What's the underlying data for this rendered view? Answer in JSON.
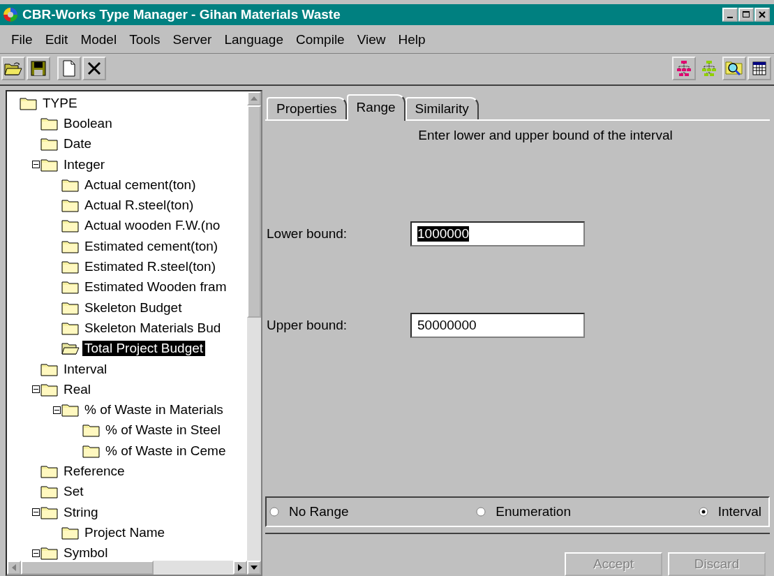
{
  "window": {
    "title": "CBR-Works Type Manager - Gihan Materials Waste"
  },
  "menu": [
    "File",
    "Edit",
    "Model",
    "Tools",
    "Server",
    "Language",
    "Compile",
    "View",
    "Help"
  ],
  "tree": [
    {
      "label": "TYPE",
      "selected": false,
      "children": [
        {
          "label": "Boolean",
          "selected": false
        },
        {
          "label": "Date",
          "selected": false
        },
        {
          "label": "Integer",
          "selected": false,
          "expanded": true,
          "children": [
            {
              "label": "Actual cement(ton)",
              "selected": false
            },
            {
              "label": "Actual R.steel(ton)",
              "selected": false
            },
            {
              "label": "Actual wooden F.W.(no",
              "selected": false
            },
            {
              "label": "Estimated cement(ton)",
              "selected": false
            },
            {
              "label": "Estimated R.steel(ton)",
              "selected": false
            },
            {
              "label": "Estimated Wooden fram",
              "selected": false
            },
            {
              "label": "Skeleton Budget",
              "selected": false
            },
            {
              "label": "Skeleton Materials Bud",
              "selected": false
            },
            {
              "label": "Total Project Budget",
              "selected": true
            }
          ]
        },
        {
          "label": "Interval",
          "selected": false
        },
        {
          "label": "Real",
          "selected": false,
          "expanded": true,
          "children": [
            {
              "label": "% of Waste in Materials",
              "selected": false,
              "expanded": true,
              "children": [
                {
                  "label": "% of Waste in Steel",
                  "selected": false
                },
                {
                  "label": "% of Waste in Ceme",
                  "selected": false
                }
              ]
            }
          ]
        },
        {
          "label": "Reference",
          "selected": false
        },
        {
          "label": "Set",
          "selected": false
        },
        {
          "label": "String",
          "selected": false,
          "expanded": true,
          "children": [
            {
              "label": "Project Name",
              "selected": false
            }
          ]
        },
        {
          "label": "Symbol",
          "selected": false,
          "expanded": true
        }
      ]
    }
  ],
  "tabs": [
    {
      "label": "Properties",
      "selected": false
    },
    {
      "label": "Range",
      "selected": true
    },
    {
      "label": "Similarity",
      "selected": false
    }
  ],
  "instruction": "Enter lower and upper bound of the interval",
  "fields": [
    {
      "label": "Lower bound:",
      "value": "1000000",
      "highlighted": true
    },
    {
      "label": "Upper bound:",
      "value": "50000000",
      "highlighted": false
    }
  ],
  "range_options": [
    {
      "label": "No Range",
      "selected": false
    },
    {
      "label": "Enumeration",
      "selected": false
    },
    {
      "label": "Interval",
      "selected": true
    }
  ],
  "buttons": [
    {
      "label": "Accept",
      "disabled": true
    },
    {
      "label": "Discard",
      "disabled": true
    }
  ]
}
